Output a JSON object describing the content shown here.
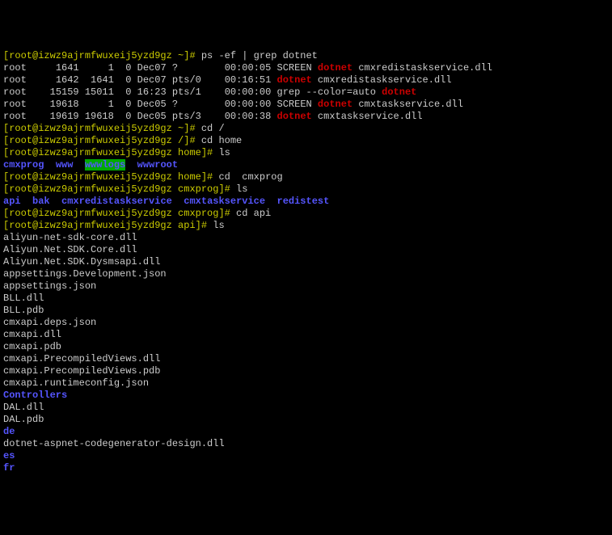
{
  "prompt1": "[root@izwz9ajrmfwuxeij5yzd9gz ~]# ",
  "cmd1": "ps -ef | grep dotnet",
  "ps": {
    "r1": {
      "user": "root",
      "pid": "     1641",
      "ppid": "     1",
      "c": "  0",
      "time": " Dec07",
      "tty": " ?     ",
      "etime": "   00:00:05",
      "cmd1": " SCREEN ",
      "hl": "dotnet",
      "cmd2": " cmxredistaskservice.dll"
    },
    "r2": {
      "user": "root",
      "pid": "     1642",
      "ppid": "  1641",
      "c": "  0",
      "time": " Dec07",
      "tty": " pts/0 ",
      "etime": "   00:16:51",
      "cmd1": " ",
      "hl": "dotnet",
      "cmd2": " cmxredistaskservice.dll"
    },
    "r3": {
      "user": "root",
      "pid": "    15159",
      "ppid": " 15011",
      "c": "  0",
      "time": " 16:23",
      "tty": " pts/1 ",
      "etime": "   00:00:00",
      "cmd1": " grep --color=auto ",
      "hl": "dotnet",
      "cmd2": ""
    },
    "r4": {
      "user": "root",
      "pid": "    19618",
      "ppid": "     1",
      "c": "  0",
      "time": " Dec05",
      "tty": " ?     ",
      "etime": "   00:00:00",
      "cmd1": " SCREEN ",
      "hl": "dotnet",
      "cmd2": " cmxtaskservice.dll"
    },
    "r5": {
      "user": "root",
      "pid": "    19619",
      "ppid": " 19618",
      "c": "  0",
      "time": " Dec05",
      "tty": " pts/3 ",
      "etime": "   00:00:38",
      "cmd1": " ",
      "hl": "dotnet",
      "cmd2": " cmxtaskservice.dll"
    }
  },
  "prompt2": "[root@izwz9ajrmfwuxeij5yzd9gz ~]# ",
  "cmd2": "cd /",
  "prompt3": "[root@izwz9ajrmfwuxeij5yzd9gz /]# ",
  "cmd3": "cd home",
  "prompt4": "[root@izwz9ajrmfwuxeij5yzd9gz home]# ",
  "cmd4": "ls",
  "ls1": {
    "a": "cmxprog",
    "s1": "  ",
    "b": "www",
    "s2": "  ",
    "c": "wwwlogs",
    "s3": "  ",
    "d": "wwwroot"
  },
  "prompt5": "[root@izwz9ajrmfwuxeij5yzd9gz home]# ",
  "cmd5": "cd  cmxprog",
  "prompt6": "[root@izwz9ajrmfwuxeij5yzd9gz cmxprog]# ",
  "cmd6": "ls",
  "ls2": {
    "a": "api",
    "s1": "  ",
    "b": "bak",
    "s2": "  ",
    "c": "cmxredistaskservice",
    "s3": "  ",
    "d": "cmxtaskservice",
    "s4": "  ",
    "e": "redistest"
  },
  "prompt7": "[root@izwz9ajrmfwuxeij5yzd9gz cmxprog]# ",
  "cmd7": "cd api",
  "prompt8": "[root@izwz9ajrmfwuxeij5yzd9gz api]# ",
  "cmd8": "ls",
  "files": {
    "f1": "aliyun-net-sdk-core.dll",
    "f2": "Aliyun.Net.SDK.Core.dll",
    "f3": "Aliyun.Net.SDK.Dysmsapi.dll",
    "f4": "appsettings.Development.json",
    "f5": "appsettings.json",
    "f6": "BLL.dll",
    "f7": "BLL.pdb",
    "f8": "cmxapi.deps.json",
    "f9": "cmxapi.dll",
    "f10": "cmxapi.pdb",
    "f11": "cmxapi.PrecompiledViews.dll",
    "f12": "cmxapi.PrecompiledViews.pdb",
    "f13": "cmxapi.runtimeconfig.json",
    "f14": "Controllers",
    "f15": "DAL.dll",
    "f16": "DAL.pdb",
    "f17": "de",
    "f18": "dotnet-aspnet-codegenerator-design.dll",
    "f19": "es",
    "f20": "fr"
  }
}
